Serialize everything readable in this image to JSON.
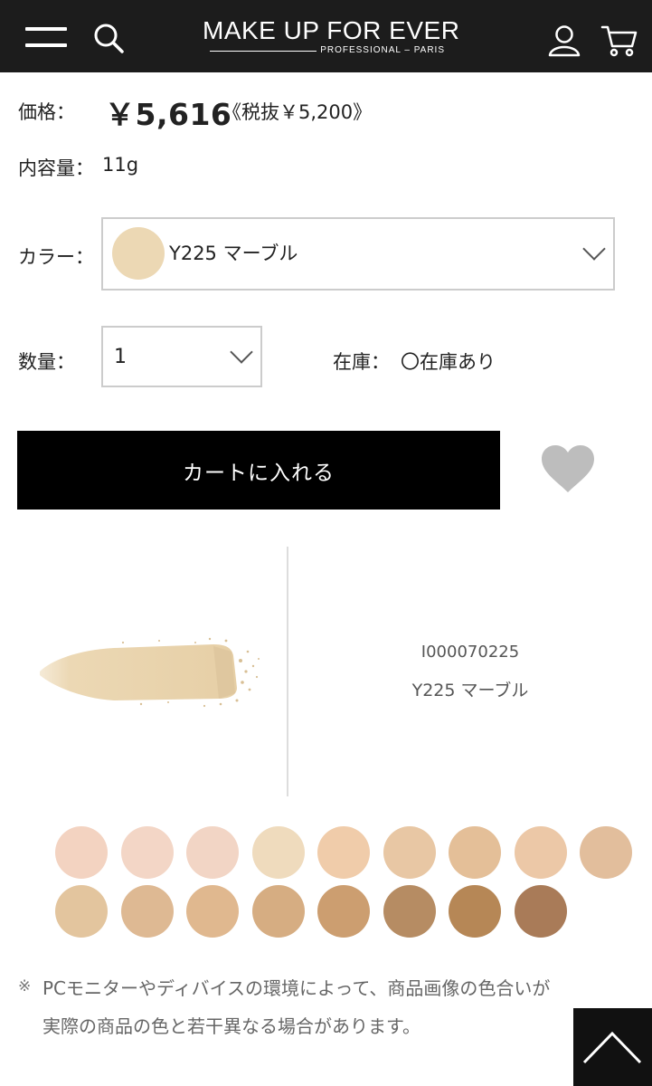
{
  "header": {
    "brand": "MAKE UP FOR EVER",
    "brand_sub": "PROFESSIONAL – PARIS",
    "icons": [
      "menu-icon",
      "search-icon",
      "user-icon",
      "cart-icon"
    ]
  },
  "product": {
    "price_label": "価格：",
    "price": "￥5,616",
    "price_tax": "《税抜￥5,200》",
    "content_label": "内容量：",
    "content_value": "11g",
    "color_label": "カラー：",
    "selected_color": "Y225 マーブル",
    "selected_color_hex": "#ecd8b4",
    "qty_label": "数量：",
    "qty_value": "1",
    "stock_label": "在庫：",
    "stock_value": "〇在庫あり",
    "add_to_cart": "カートに入れる",
    "sku": "I000070225",
    "sku_name": "Y225 マーブル"
  },
  "shades_row1": [
    "#f3d3c1",
    "#f3d6c6",
    "#f2d5c5",
    "#efdbbd",
    "#f0ccaa",
    "#e8c7a4",
    "#e4bf98",
    "#ecc8a7",
    "#e2be9c"
  ],
  "shades_row2": [
    "#e3c59e",
    "#deb993",
    "#e0b88f",
    "#d6ad82",
    "#cc9e70",
    "#b68c63",
    "#b68756",
    "#a97b58"
  ],
  "note": {
    "mark": "※",
    "line1": "PCモニターやディバイスの環境によって、商品画像の色合いが",
    "line2": "実際の商品の色と若干異なる場合があります。"
  },
  "colors": {
    "header_bg": "#1c1c1c",
    "button_bg": "#000000",
    "heart": "#bdbdbd",
    "powder": "#ecd8b4"
  }
}
